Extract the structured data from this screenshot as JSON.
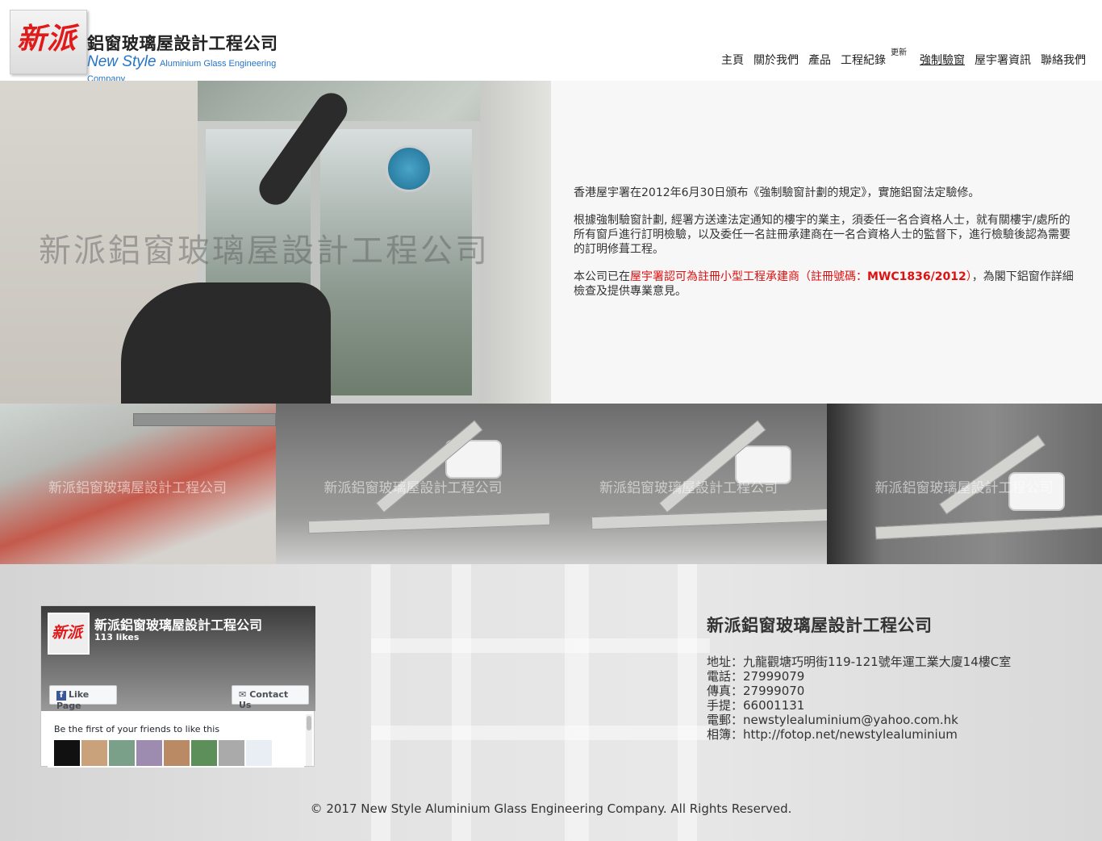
{
  "header": {
    "logo_mark": "新派",
    "logo_name_cn": "鋁窗玻璃屋設計工程公司",
    "logo_name_en_big": "New Style",
    "logo_name_en_small": "Aluminium Glass Engineering Company"
  },
  "nav": {
    "items": [
      {
        "label": "主頁"
      },
      {
        "label": "關於我們"
      },
      {
        "label": "產品"
      },
      {
        "label": "工程紀錄",
        "badge": "更新"
      },
      {
        "label": "強制驗窗"
      },
      {
        "label": "屋宇署資訊"
      },
      {
        "label": "聯絡我們"
      }
    ],
    "active_index": 4
  },
  "hero": {
    "watermark": "新派鋁窗玻璃屋設計工程公司",
    "para1": "香港屋宇署在2012年6月30日頒布《強制驗窗計劃的規定》，實施鋁窗法定驗修。",
    "para2": "根據強制驗窗計劃, 經署方送達法定通知的樓宇的業主，須委任一名合資格人士，就有關樓宇/處所的所有窗戶進行訂明檢驗，以及委任一名註冊承建商在一名合資格人士的監督下，進行檢驗後認為需要的訂明修葺工程。",
    "para3_pre": "本公司已在",
    "para3_red_a": "屋宇署認可為註冊小型工程承建商（註冊號碼：",
    "para3_red_b": "MWC1836/2012",
    "para3_red_c": "）",
    "para3_post": "，為閣下鋁窗作詳細檢查及提供專業意見。"
  },
  "gallery": {
    "watermark": "新派鋁窗玻璃屋設計工程公司"
  },
  "facebook": {
    "avatar_text": "新派",
    "page_name": "新派鋁窗玻璃屋設計工程公司",
    "likes": "113 likes",
    "like_button": "Like Page",
    "contact_button": "Contact Us",
    "friends_text": "Be the first of your friends to like this"
  },
  "contact": {
    "title": "新派鋁窗玻璃屋設計工程公司",
    "address": "地址：九龍觀塘巧明街119-121號年運工業大廈14樓C室",
    "phone": "電話：27999079",
    "fax": "傳真：27999070",
    "mobile": "手提：66001131",
    "email": "電郵：newstylealuminium@yahoo.com.hk",
    "album": "相簿：http://fotop.net/newstylealuminium"
  },
  "footer": {
    "copyright": "© 2017 New Style Aluminium Glass Engineering Company. All Rights Reserved."
  }
}
